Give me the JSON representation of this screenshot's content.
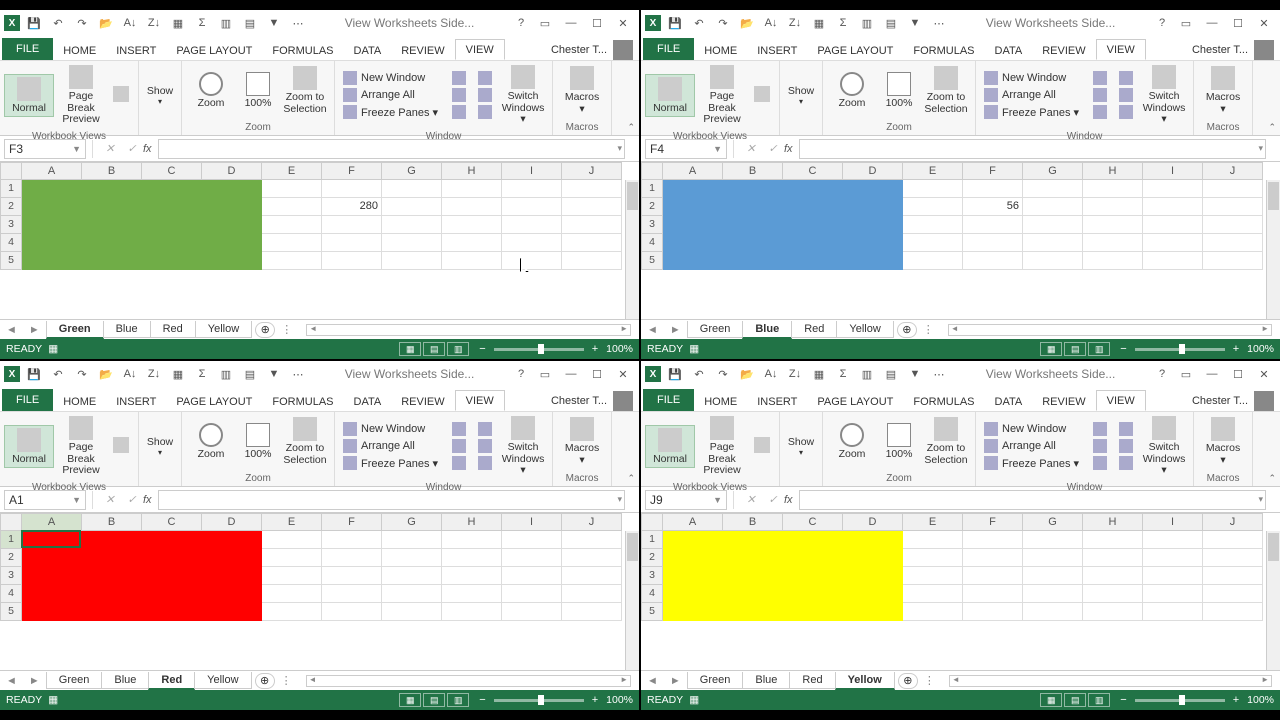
{
  "common": {
    "title": "View Worksheets Side...",
    "user": "Chester T...",
    "ribbon_tabs": {
      "file": "FILE",
      "home": "HOME",
      "insert": "INSERT",
      "page_layout": "PAGE LAYOUT",
      "formulas": "FORMULAS",
      "data": "DATA",
      "review": "REVIEW",
      "view": "VIEW"
    },
    "view_ribbon": {
      "normal": "Normal",
      "pagebreak": "Page Break Preview",
      "show": "Show",
      "zoom": "Zoom",
      "zoom100": "100%",
      "zoomsel": "Zoom to Selection",
      "newwin": "New Window",
      "arrange": "Arrange All",
      "freeze": "Freeze Panes",
      "switch": "Switch Windows",
      "macros": "Macros",
      "g_views": "Workbook Views",
      "g_zoom": "Zoom",
      "g_window": "Window",
      "g_macros": "Macros"
    },
    "columns": [
      "A",
      "B",
      "C",
      "D",
      "E",
      "F",
      "G",
      "H",
      "I",
      "J"
    ],
    "row_nums": [
      1,
      2,
      3,
      4,
      5
    ],
    "sheets": [
      "Green",
      "Blue",
      "Red",
      "Yellow"
    ],
    "status_ready": "READY",
    "zoom_pct": "100%",
    "qat_help": "?"
  },
  "windows": {
    "tl": {
      "active_tab": "Green",
      "namebox": "F3",
      "cellvalue": "280",
      "cellcol": "F",
      "cellrow": 2,
      "block_color": "#70ad47",
      "active_window": true,
      "sel_cell": null
    },
    "tr": {
      "active_tab": "Blue",
      "namebox": "F4",
      "cellvalue": "56",
      "cellcol": "F",
      "cellrow": 2,
      "block_color": "#5b9bd5",
      "active_window": false,
      "sel_cell": null
    },
    "bl": {
      "active_tab": "Red",
      "namebox": "A1",
      "cellvalue": "",
      "cellcol": null,
      "cellrow": null,
      "block_color": "#ff0000",
      "active_window": true,
      "sel_cell": {
        "col": "A",
        "row": 1
      }
    },
    "br": {
      "active_tab": "Yellow",
      "namebox": "J9",
      "cellvalue": "",
      "cellcol": null,
      "cellrow": null,
      "block_color": "#ffff00",
      "active_window": false,
      "sel_cell": null
    }
  }
}
